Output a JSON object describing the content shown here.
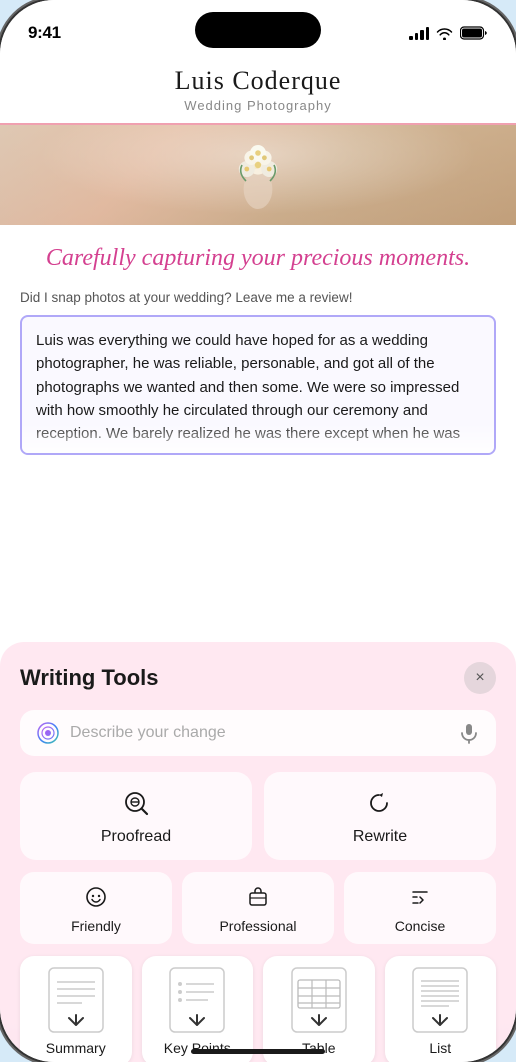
{
  "status_bar": {
    "time": "9:41",
    "signal_label": "signal",
    "wifi_label": "wifi",
    "battery_label": "battery"
  },
  "site": {
    "title": "Luis Coderque",
    "subtitle": "Wedding Photography"
  },
  "tagline": "Carefully capturing your precious moments.",
  "review_prompt": "Did I snap photos at your wedding? Leave me a review!",
  "review_text": "Luis was everything we could have hoped for as a wedding photographer, he was reliable, personable, and got all of the photographs we wanted and then some. We were so impressed with how smoothly he circulated through our ceremony and reception. We barely realized he was there except when he was very",
  "writing_tools": {
    "title": "Writing Tools",
    "close_label": "×",
    "search_placeholder": "Describe your change",
    "buttons_large": [
      {
        "id": "proofread",
        "label": "Proofread",
        "icon": "proofread"
      },
      {
        "id": "rewrite",
        "label": "Rewrite",
        "icon": "rewrite"
      }
    ],
    "buttons_medium": [
      {
        "id": "friendly",
        "label": "Friendly",
        "icon": "friendly"
      },
      {
        "id": "professional",
        "label": "Professional",
        "icon": "professional"
      },
      {
        "id": "concise",
        "label": "Concise",
        "icon": "concise"
      }
    ],
    "buttons_small": [
      {
        "id": "summary",
        "label": "Summary",
        "icon": "summary"
      },
      {
        "id": "key-points",
        "label": "Key Points",
        "icon": "key-points"
      },
      {
        "id": "table",
        "label": "Table",
        "icon": "table"
      },
      {
        "id": "list",
        "label": "List",
        "icon": "list"
      }
    ]
  }
}
